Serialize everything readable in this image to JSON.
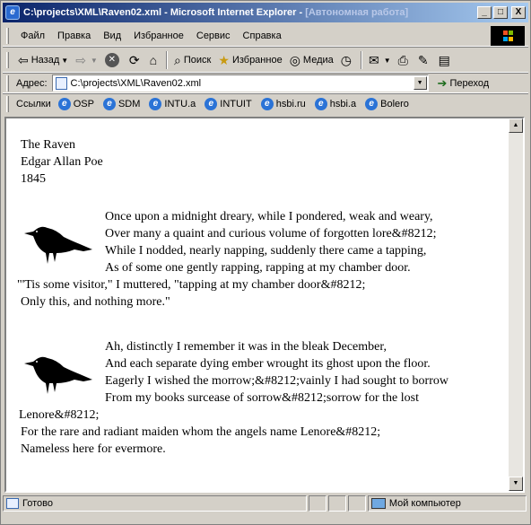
{
  "window": {
    "title": "C:\\projects\\XML\\Raven02.xml - Microsoft Internet Explorer - ",
    "title_offline": "[Автономная работа]",
    "buttons": {
      "minimize": "_",
      "maximize": "□",
      "close": "X"
    }
  },
  "menu": {
    "items": [
      "Файл",
      "Правка",
      "Вид",
      "Избранное",
      "Сервис",
      "Справка"
    ]
  },
  "toolbar": {
    "back_label": "Назад",
    "search_label": "Поиск",
    "favorites_label": "Избранное",
    "media_label": "Медиа"
  },
  "address": {
    "label": "Адрес:",
    "value": "C:\\projects\\XML\\Raven02.xml",
    "go_label": "Переход"
  },
  "links": {
    "label": "Ссылки",
    "items": [
      "OSP",
      "SDM",
      "INTU.a",
      "INTUIT",
      "hsbi.ru",
      "hsbi.a",
      "Bolero"
    ]
  },
  "document": {
    "title": "The Raven",
    "author": "Edgar Allan Poe",
    "year": "1845",
    "stanzas": [
      {
        "indented_lines": [
          "Once upon a midnight dreary, while I pondered, weak and weary,",
          "Over many a quaint and curious volume of forgotten lore&#8212;",
          "While I nodded, nearly napping, suddenly there came a tapping,",
          "As of some one gently rapping, rapping at my chamber door."
        ],
        "full_lines": [
          "\"'Tis some visitor,\" I muttered, \"tapping at my chamber door&#8212;",
          "Only this, and nothing more.\""
        ]
      },
      {
        "indented_lines": [
          "Ah, distinctly I remember it was in the bleak December,",
          "And each separate dying ember wrought its ghost upon the floor.",
          "Eagerly I wished the morrow;&#8212;vainly I had sought to borrow",
          "From my books surcease of sorrow&#8212;sorrow for the lost"
        ],
        "full_lines": [
          "Lenore&#8212;",
          "For the rare and radiant maiden whom the angels name Lenore&#8212;",
          "Nameless here for evermore."
        ]
      }
    ]
  },
  "status": {
    "text": "Готово",
    "zone": "Мой компьютер"
  },
  "colors": {
    "title_bar_start": "#0a246a",
    "title_bar_end": "#a6caf0",
    "chrome": "#d4d0c8"
  }
}
